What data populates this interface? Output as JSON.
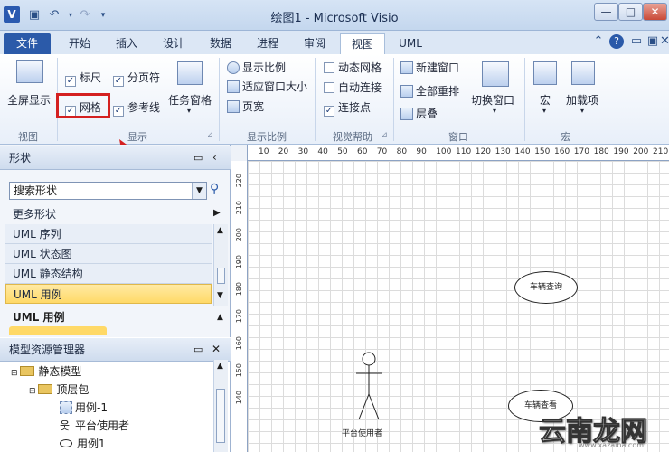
{
  "window": {
    "title": "绘图1 - Microsoft Visio",
    "app_icon": "V",
    "controls": [
      "—",
      "□",
      "✕"
    ]
  },
  "tabs": [
    {
      "label": "文件"
    },
    {
      "label": "开始"
    },
    {
      "label": "插入"
    },
    {
      "label": "设计"
    },
    {
      "label": "数据"
    },
    {
      "label": "进程"
    },
    {
      "label": "审阅"
    },
    {
      "label": "视图"
    },
    {
      "label": "UML"
    }
  ],
  "ribbon": {
    "view_group": {
      "fullscreen": "全屏显示",
      "label": "视图"
    },
    "show_group": {
      "ruler": "标尺",
      "page_breaks": "分页符",
      "grid": "网格",
      "guides": "参考线",
      "task_panes": "任务窗格",
      "label": "显示"
    },
    "zoom_group": {
      "zoom": "显示比例",
      "fit_window": "适应窗口大小",
      "page_width": "页宽",
      "label": "显示比例"
    },
    "visual_aids_group": {
      "dynamic_grid": "动态网格",
      "auto_connect": "自动连接",
      "connection_points": "连接点",
      "label": "视觉帮助"
    },
    "window_group": {
      "new_window": "新建窗口",
      "arrange_all": "全部重排",
      "cascade": "层叠",
      "switch_windows": "切换窗口",
      "label": "窗口"
    },
    "macros_group": {
      "macros": "宏",
      "addins": "加载项",
      "label": "宏"
    }
  },
  "shapes_pane": {
    "title": "形状",
    "search_value": "搜索形状",
    "more_shapes": "更多形状",
    "stencils": [
      "UML 序列",
      "UML 状态图",
      "UML 静态结构",
      "UML 用例"
    ],
    "active_stencil_header": "UML 用例"
  },
  "model_explorer": {
    "title": "模型资源管理器",
    "items": [
      "静态模型",
      "顶层包",
      "用例-1",
      "平台使用者",
      "用例1"
    ]
  },
  "ruler_top": [
    "10",
    "20",
    "30",
    "40",
    "50",
    "60",
    "70",
    "80",
    "90",
    "100",
    "110",
    "120",
    "130",
    "140",
    "150",
    "160",
    "170",
    "180",
    "190",
    "200",
    "210"
  ],
  "ruler_left": [
    "220",
    "210",
    "200",
    "190",
    "180",
    "170",
    "160",
    "150",
    "140"
  ],
  "canvas": {
    "usecase_1": "车辆查询",
    "usecase_2": "车辆查看",
    "actor_label": "平台使用者"
  },
  "watermark": {
    "text": "云南龙网",
    "url": "www.xazaiba.com"
  }
}
